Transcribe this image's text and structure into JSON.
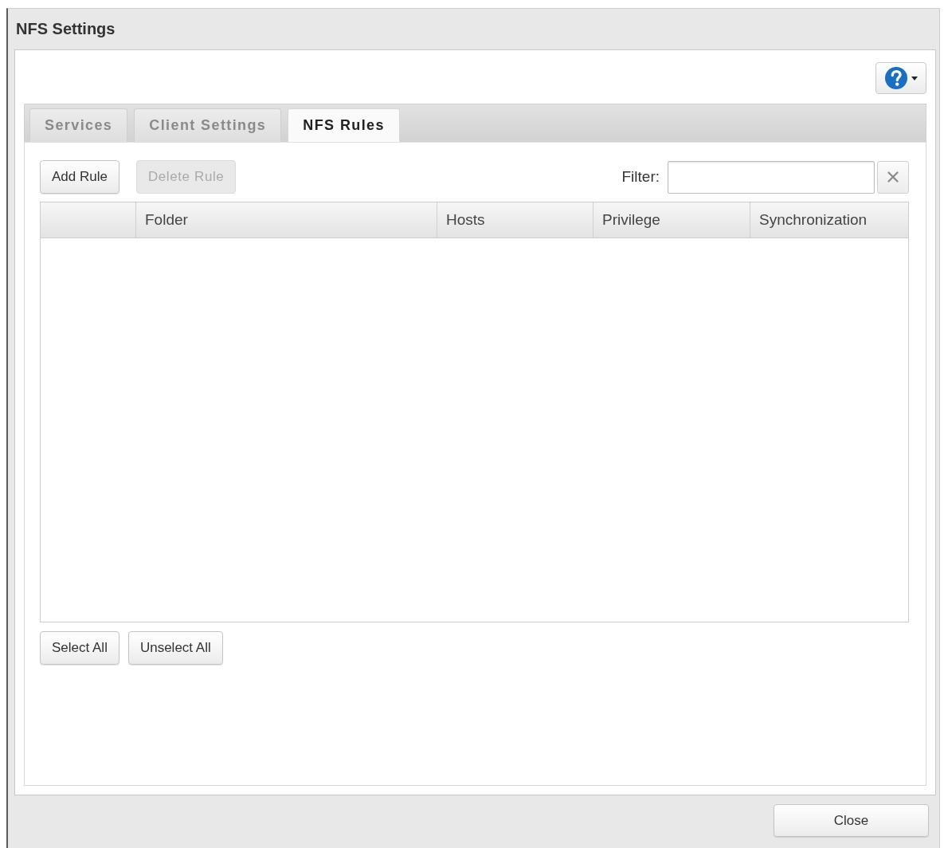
{
  "window": {
    "title": "NFS Settings"
  },
  "tabs": [
    {
      "label": "Services",
      "selected": false
    },
    {
      "label": "Client Settings",
      "selected": false
    },
    {
      "label": "NFS Rules",
      "selected": true
    }
  ],
  "toolbar": {
    "buttons": [
      {
        "label": "Add Rule",
        "disabled": false
      },
      {
        "label": "Delete Rule",
        "disabled": true
      }
    ],
    "filter": {
      "label": "Filter:"
    }
  },
  "table": {
    "columns": [
      "Folder",
      "Hosts",
      "Privilege",
      "Synchronization"
    ]
  },
  "selection_buttons": [
    "Select All",
    "Unselect All"
  ],
  "footer": {
    "buttons": [
      "Close"
    ]
  }
}
